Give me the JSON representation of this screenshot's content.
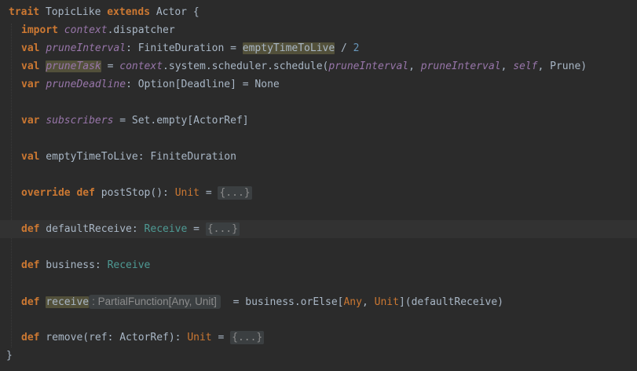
{
  "code": {
    "l1": {
      "kw": "trait",
      "name": " TopicLike ",
      "kw2": "extends",
      "rest": " Actor {"
    },
    "l2": {
      "kw": "import",
      "it": "context",
      "rest": ".dispatcher"
    },
    "l3": {
      "kw": "val",
      "it": "pruneInterval",
      "mid": ": FiniteDuration = ",
      "hl": "emptyTimeToLive",
      "op": " / ",
      "num": "2"
    },
    "l4": {
      "kw": "val",
      "it": "pruneTask",
      "eq": " = ",
      "ctx": "context",
      "mid": ".system.scheduler.schedule(",
      "a1": "pruneInterval",
      "c1": ", ",
      "a2": "pruneInterval",
      "c2": ", ",
      "a3": "self",
      "end": ", Prune)"
    },
    "l5": {
      "kw": "var",
      "it": "pruneDeadline",
      "rest": ": Option[Deadline] = None"
    },
    "l6": {
      "kw": "var",
      "it": "subscribers",
      "rest": " = Set.empty[ActorRef]"
    },
    "l7": {
      "kw": "val",
      "rest": " emptyTimeToLive: FiniteDuration"
    },
    "l8": {
      "kw": "override",
      "kw2": "def",
      "name": " postStop(): ",
      "ty": "Unit",
      "eq": " = ",
      "fold": "{...}"
    },
    "l9": {
      "kw": "def",
      "name": " defaultReceive: ",
      "ty": "Receive",
      "eq": " = ",
      "fold": "{...}"
    },
    "l10": {
      "kw": "def",
      "name": " business: ",
      "ty": "Receive"
    },
    "l11": {
      "kw": "def",
      "hl": "receive",
      "hint": ": PartialFunction[Any, Unit]",
      "mid": "  = business.orElse[",
      "t1": "Any",
      "c1": ", ",
      "t2": "Unit",
      "end": "](defaultReceive)"
    },
    "l12": {
      "kw": "def",
      "name": " remove(ref: ActorRef): ",
      "ty": "Unit",
      "eq": " = ",
      "fold": "{...}"
    },
    "l13": {
      "rest": "}"
    }
  }
}
